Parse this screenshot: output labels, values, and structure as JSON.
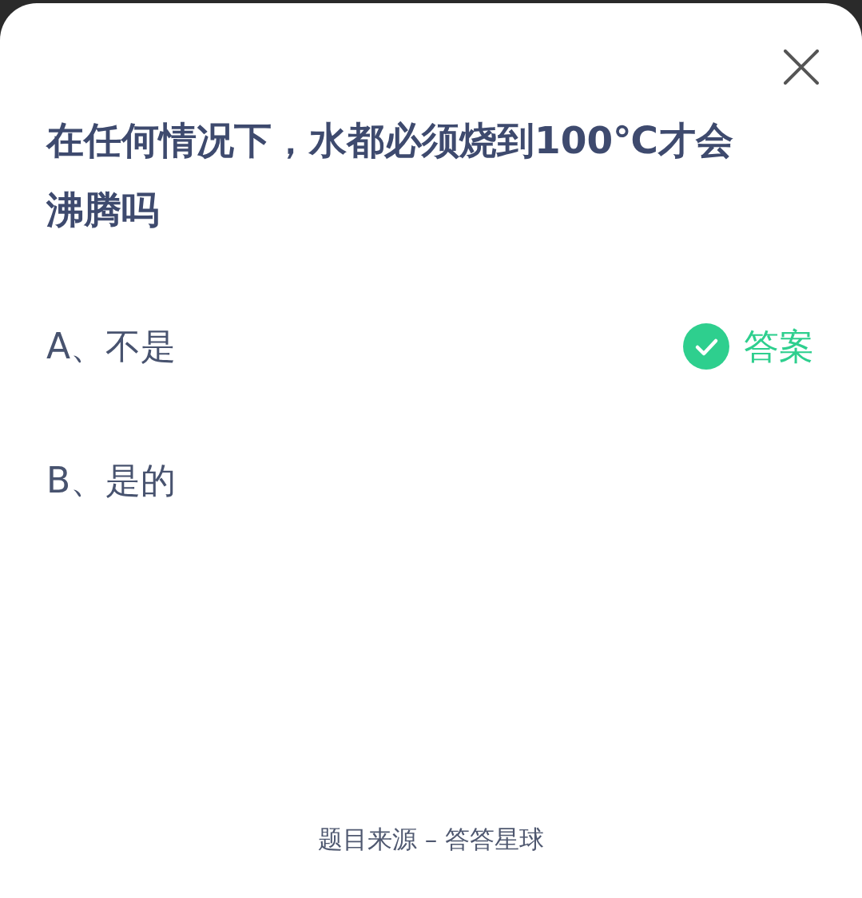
{
  "question": "在任何情况下，水都必须烧到100℃才会沸腾吗",
  "options": [
    {
      "text": "A、不是",
      "is_answer": true,
      "answer_label": "答案"
    },
    {
      "text": "B、是的",
      "is_answer": false
    }
  ],
  "footer": "题目来源 – 答答星球"
}
